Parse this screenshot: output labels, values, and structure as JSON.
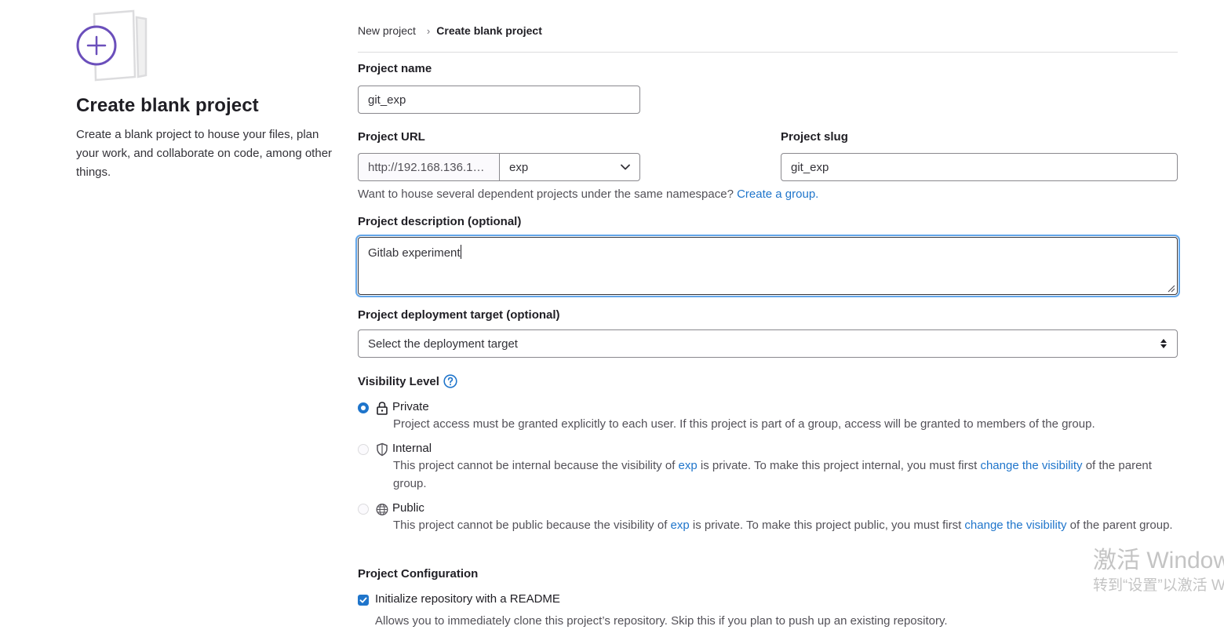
{
  "left": {
    "title": "Create blank project",
    "description": "Create a blank project to house your files, plan your work, and collaborate on code, among other things."
  },
  "breadcrumb": {
    "parent": "New project",
    "separator": "›",
    "current": "Create blank project"
  },
  "form": {
    "project_name": {
      "label": "Project name",
      "value": "git_exp"
    },
    "project_url": {
      "label": "Project URL",
      "prefix": "http://192.168.136.1…",
      "namespace": "exp"
    },
    "project_slug": {
      "label": "Project slug",
      "value": "git_exp"
    },
    "group_hint": {
      "text": "Want to house several dependent projects under the same namespace?",
      "link": "Create a group."
    },
    "description": {
      "label": "Project description (optional)",
      "value": "Gitlab experiment"
    },
    "deployment": {
      "label": "Project deployment target (optional)",
      "selected": "Select the deployment target"
    },
    "visibility": {
      "label": "Visibility Level",
      "private": {
        "title": "Private",
        "help": "Project access must be granted explicitly to each user. If this project is part of a group, access will be granted to members of the group."
      },
      "internal": {
        "title": "Internal",
        "help_a": "This project cannot be internal because the visibility of",
        "group_link": "exp",
        "help_b": "is private. To make this project internal, you must first",
        "change_link": "change the visibility",
        "help_c": "of the parent group."
      },
      "public": {
        "title": "Public",
        "help_a": "This project cannot be public because the visibility of",
        "group_link": "exp",
        "help_b": "is private. To make this project public, you must first",
        "change_link": "change the visibility",
        "help_c": "of the parent group."
      }
    },
    "configuration": {
      "label": "Project Configuration",
      "readme_label": "Initialize repository with a README",
      "readme_help": "Allows you to immediately clone this project’s repository. Skip this if you plan to push up an existing repository."
    }
  },
  "watermark": {
    "line1": "激活 Windows",
    "line2": "转到“设置”以激活 Windows。"
  },
  "colors": {
    "link": "#1f75cb",
    "accent": "#6b4fbb",
    "focus": "#63a6e9"
  },
  "icons": [
    "new-project-illustration",
    "chevron-right-icon",
    "chevron-down-icon",
    "sort-arrows-icon",
    "question-circle-icon",
    "lock-icon",
    "shield-icon",
    "globe-icon",
    "check-icon"
  ]
}
